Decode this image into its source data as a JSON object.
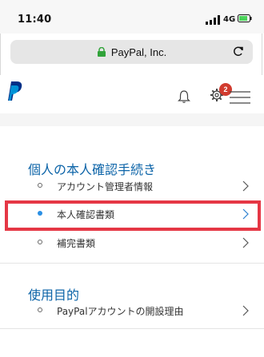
{
  "status_bar": {
    "time": "11:40",
    "network": "4G"
  },
  "browser": {
    "site_label": "PayPal, Inc."
  },
  "header": {
    "notification_count": "2",
    "brand_color": "#003087"
  },
  "sections": [
    {
      "title": "個人の本人確認手続き",
      "items": [
        {
          "label": "アカウント管理者情報",
          "selected": false
        },
        {
          "label": "本人確認書類",
          "selected": true
        },
        {
          "label": "補完書類",
          "selected": false
        }
      ]
    },
    {
      "title": "使用目的",
      "items": [
        {
          "label": "PayPalアカウントの開設理由",
          "selected": false
        }
      ]
    }
  ],
  "colors": {
    "accent_blue": "#0c64a8",
    "highlight_red": "#e53745",
    "badge_red": "#d13b2f"
  }
}
